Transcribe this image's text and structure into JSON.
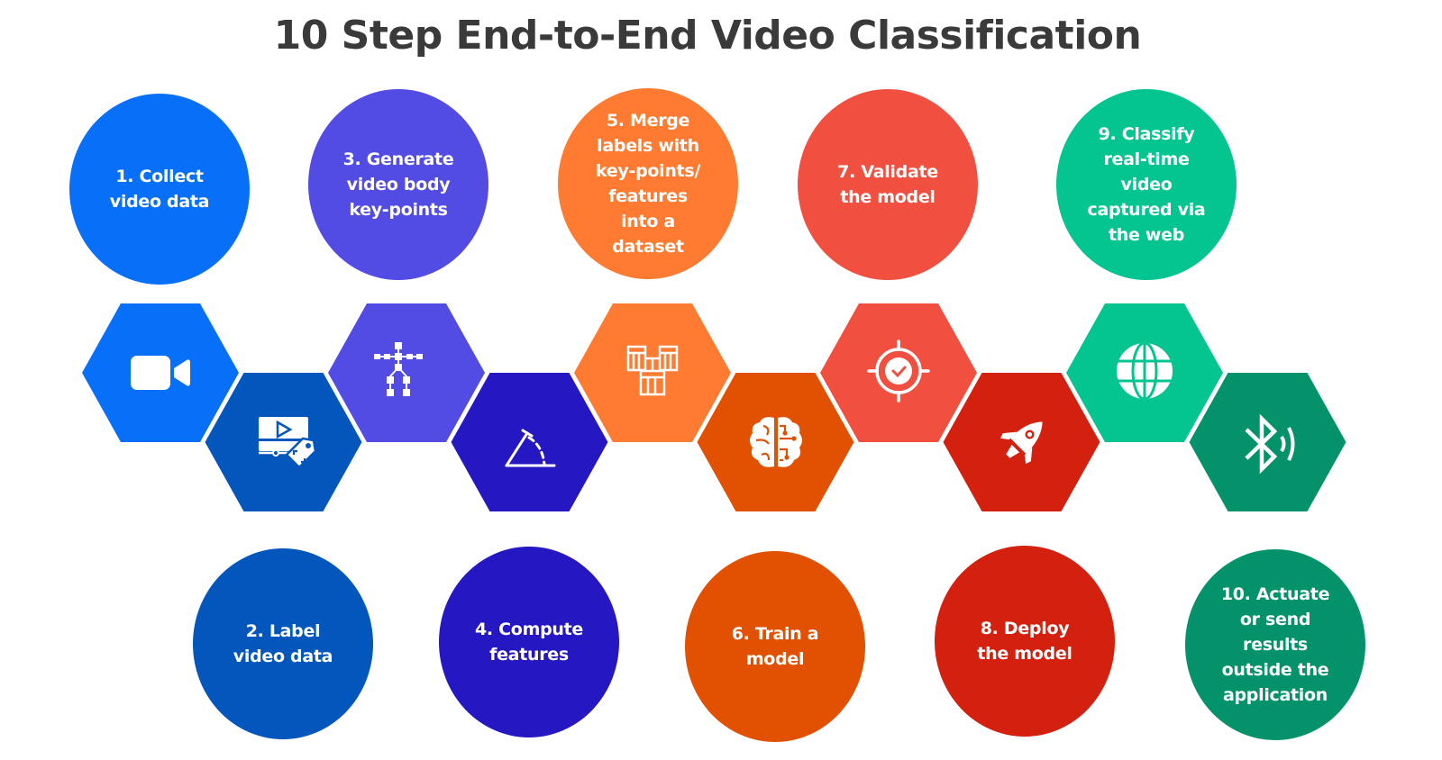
{
  "title": "10 Step End-to-End Video Classification",
  "steps": [
    {
      "number": 1,
      "label": "1. Collect\nvideo data",
      "icon": "video-camera-icon",
      "color": "#0870f8",
      "hex_color": "#0870f8"
    },
    {
      "number": 2,
      "label": "2. Label\nvideo data",
      "icon": "video-label-tag-icon",
      "color": "#0356bb",
      "hex_color": "#0356bb"
    },
    {
      "number": 3,
      "label": "3. Generate\nvideo body\nkey-points",
      "icon": "skeleton-keypoints-icon",
      "color": "#524be4",
      "hex_color": "#524be4"
    },
    {
      "number": 4,
      "label": "4. Compute\nfeatures",
      "icon": "angle-measure-icon",
      "color": "#2518c2",
      "hex_color": "#2518c2"
    },
    {
      "number": 5,
      "label": "5. Merge\nlabels with\nkey-points/\nfeatures\ninto a\ndataset",
      "icon": "merge-tables-icon",
      "color": "#fe7b31",
      "hex_color": "#fe7b31"
    },
    {
      "number": 6,
      "label": "6. Train a\nmodel",
      "icon": "brain-circuit-icon",
      "color": "#e25101",
      "hex_color": "#e25101"
    },
    {
      "number": 7,
      "label": "7. Validate\nthe model",
      "icon": "target-check-icon",
      "color": "#f15040",
      "hex_color": "#f15040"
    },
    {
      "number": 8,
      "label": "8. Deploy\nthe model",
      "icon": "rocket-icon",
      "color": "#d4200f",
      "hex_color": "#d4200f"
    },
    {
      "number": 9,
      "label": "9. Classify\nreal-time\nvideo\ncaptured via\nthe web",
      "icon": "globe-icon",
      "color": "#04c48f",
      "hex_color": "#04c48f"
    },
    {
      "number": 10,
      "label": "10. Actuate\nor send\nresults\noutside the\napplication",
      "icon": "bluetooth-signal-icon",
      "color": "#04926b",
      "hex_color": "#04926b"
    }
  ]
}
